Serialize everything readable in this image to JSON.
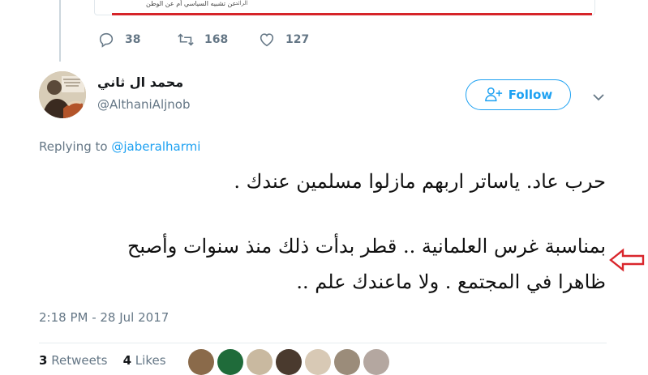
{
  "quoted_card": {
    "caption_main": "عن تشبيه السياسي أم عن الوطن",
    "caption_side": "الرائد"
  },
  "parent_actions": {
    "replies": "38",
    "retweets": "168",
    "likes": "127"
  },
  "author": {
    "display_name": "محمد ال ثاني",
    "handle": "@AlthaniAljnob"
  },
  "follow_button": {
    "label": "Follow"
  },
  "replying": {
    "prefix": "Replying to",
    "mention": "@jaberalharmi"
  },
  "tweet_lines": [
    "حرب عاد. ياساتر اربهم مازلوا مسلمين عندك .",
    "بمناسبة غرس العلمانية .. قطر بدأت ذلك منذ سنوات وأصبح",
    "ظاهرا في المجتمع . ولا ماعندك علم .."
  ],
  "timestamp": "2:18 PM - 28 Jul 2017",
  "stats": {
    "retweets_count": "3",
    "retweets_label": "Retweets",
    "likes_count": "4",
    "likes_label": "Likes"
  },
  "colors": {
    "accent": "#1da1f2",
    "muted": "#657786",
    "annotation_arrow": "#d9262c"
  },
  "icons": [
    "reply-icon",
    "retweet-icon",
    "heart-icon",
    "follow-person-icon",
    "chevron-down-icon",
    "annotation-arrow-icon"
  ]
}
